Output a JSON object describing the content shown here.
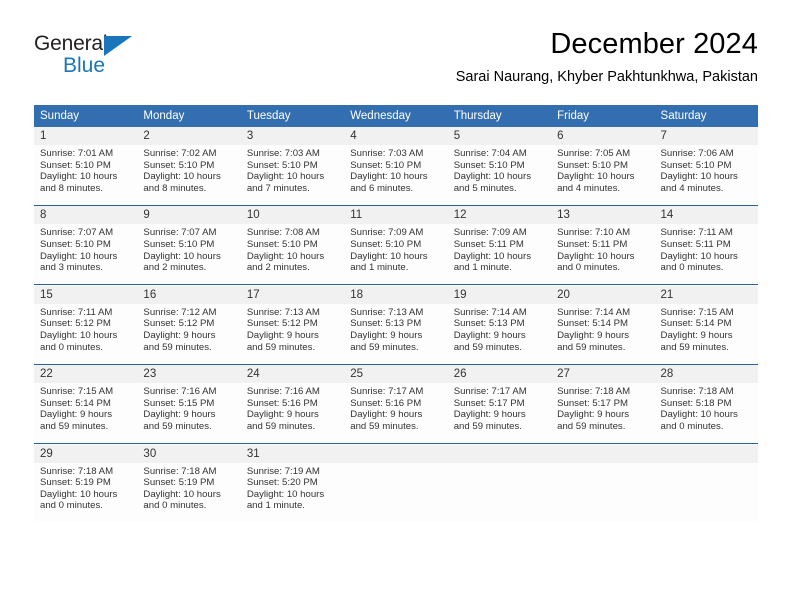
{
  "brand": {
    "name_top": "General",
    "name_bottom": "Blue",
    "accent_color": "#1b75bb",
    "triangle_icon": "triangle-icon"
  },
  "header": {
    "title": "December 2024",
    "location": "Sarai Naurang, Khyber Pakhtunkhwa, Pakistan"
  },
  "calendar": {
    "header_bg": "#336fb0",
    "daynum_bg": "#f1f1f1",
    "divider_color": "#2a6099",
    "weekdays": [
      "Sunday",
      "Monday",
      "Tuesday",
      "Wednesday",
      "Thursday",
      "Friday",
      "Saturday"
    ],
    "weeks": [
      [
        {
          "day": "1",
          "sunrise": "Sunrise: 7:01 AM",
          "sunset": "Sunset: 5:10 PM",
          "daylight1": "Daylight: 10 hours",
          "daylight2": "and 8 minutes."
        },
        {
          "day": "2",
          "sunrise": "Sunrise: 7:02 AM",
          "sunset": "Sunset: 5:10 PM",
          "daylight1": "Daylight: 10 hours",
          "daylight2": "and 8 minutes."
        },
        {
          "day": "3",
          "sunrise": "Sunrise: 7:03 AM",
          "sunset": "Sunset: 5:10 PM",
          "daylight1": "Daylight: 10 hours",
          "daylight2": "and 7 minutes."
        },
        {
          "day": "4",
          "sunrise": "Sunrise: 7:03 AM",
          "sunset": "Sunset: 5:10 PM",
          "daylight1": "Daylight: 10 hours",
          "daylight2": "and 6 minutes."
        },
        {
          "day": "5",
          "sunrise": "Sunrise: 7:04 AM",
          "sunset": "Sunset: 5:10 PM",
          "daylight1": "Daylight: 10 hours",
          "daylight2": "and 5 minutes."
        },
        {
          "day": "6",
          "sunrise": "Sunrise: 7:05 AM",
          "sunset": "Sunset: 5:10 PM",
          "daylight1": "Daylight: 10 hours",
          "daylight2": "and 4 minutes."
        },
        {
          "day": "7",
          "sunrise": "Sunrise: 7:06 AM",
          "sunset": "Sunset: 5:10 PM",
          "daylight1": "Daylight: 10 hours",
          "daylight2": "and 4 minutes."
        }
      ],
      [
        {
          "day": "8",
          "sunrise": "Sunrise: 7:07 AM",
          "sunset": "Sunset: 5:10 PM",
          "daylight1": "Daylight: 10 hours",
          "daylight2": "and 3 minutes."
        },
        {
          "day": "9",
          "sunrise": "Sunrise: 7:07 AM",
          "sunset": "Sunset: 5:10 PM",
          "daylight1": "Daylight: 10 hours",
          "daylight2": "and 2 minutes."
        },
        {
          "day": "10",
          "sunrise": "Sunrise: 7:08 AM",
          "sunset": "Sunset: 5:10 PM",
          "daylight1": "Daylight: 10 hours",
          "daylight2": "and 2 minutes."
        },
        {
          "day": "11",
          "sunrise": "Sunrise: 7:09 AM",
          "sunset": "Sunset: 5:10 PM",
          "daylight1": "Daylight: 10 hours",
          "daylight2": "and 1 minute."
        },
        {
          "day": "12",
          "sunrise": "Sunrise: 7:09 AM",
          "sunset": "Sunset: 5:11 PM",
          "daylight1": "Daylight: 10 hours",
          "daylight2": "and 1 minute."
        },
        {
          "day": "13",
          "sunrise": "Sunrise: 7:10 AM",
          "sunset": "Sunset: 5:11 PM",
          "daylight1": "Daylight: 10 hours",
          "daylight2": "and 0 minutes."
        },
        {
          "day": "14",
          "sunrise": "Sunrise: 7:11 AM",
          "sunset": "Sunset: 5:11 PM",
          "daylight1": "Daylight: 10 hours",
          "daylight2": "and 0 minutes."
        }
      ],
      [
        {
          "day": "15",
          "sunrise": "Sunrise: 7:11 AM",
          "sunset": "Sunset: 5:12 PM",
          "daylight1": "Daylight: 10 hours",
          "daylight2": "and 0 minutes."
        },
        {
          "day": "16",
          "sunrise": "Sunrise: 7:12 AM",
          "sunset": "Sunset: 5:12 PM",
          "daylight1": "Daylight: 9 hours",
          "daylight2": "and 59 minutes."
        },
        {
          "day": "17",
          "sunrise": "Sunrise: 7:13 AM",
          "sunset": "Sunset: 5:12 PM",
          "daylight1": "Daylight: 9 hours",
          "daylight2": "and 59 minutes."
        },
        {
          "day": "18",
          "sunrise": "Sunrise: 7:13 AM",
          "sunset": "Sunset: 5:13 PM",
          "daylight1": "Daylight: 9 hours",
          "daylight2": "and 59 minutes."
        },
        {
          "day": "19",
          "sunrise": "Sunrise: 7:14 AM",
          "sunset": "Sunset: 5:13 PM",
          "daylight1": "Daylight: 9 hours",
          "daylight2": "and 59 minutes."
        },
        {
          "day": "20",
          "sunrise": "Sunrise: 7:14 AM",
          "sunset": "Sunset: 5:14 PM",
          "daylight1": "Daylight: 9 hours",
          "daylight2": "and 59 minutes."
        },
        {
          "day": "21",
          "sunrise": "Sunrise: 7:15 AM",
          "sunset": "Sunset: 5:14 PM",
          "daylight1": "Daylight: 9 hours",
          "daylight2": "and 59 minutes."
        }
      ],
      [
        {
          "day": "22",
          "sunrise": "Sunrise: 7:15 AM",
          "sunset": "Sunset: 5:14 PM",
          "daylight1": "Daylight: 9 hours",
          "daylight2": "and 59 minutes."
        },
        {
          "day": "23",
          "sunrise": "Sunrise: 7:16 AM",
          "sunset": "Sunset: 5:15 PM",
          "daylight1": "Daylight: 9 hours",
          "daylight2": "and 59 minutes."
        },
        {
          "day": "24",
          "sunrise": "Sunrise: 7:16 AM",
          "sunset": "Sunset: 5:16 PM",
          "daylight1": "Daylight: 9 hours",
          "daylight2": "and 59 minutes."
        },
        {
          "day": "25",
          "sunrise": "Sunrise: 7:17 AM",
          "sunset": "Sunset: 5:16 PM",
          "daylight1": "Daylight: 9 hours",
          "daylight2": "and 59 minutes."
        },
        {
          "day": "26",
          "sunrise": "Sunrise: 7:17 AM",
          "sunset": "Sunset: 5:17 PM",
          "daylight1": "Daylight: 9 hours",
          "daylight2": "and 59 minutes."
        },
        {
          "day": "27",
          "sunrise": "Sunrise: 7:18 AM",
          "sunset": "Sunset: 5:17 PM",
          "daylight1": "Daylight: 9 hours",
          "daylight2": "and 59 minutes."
        },
        {
          "day": "28",
          "sunrise": "Sunrise: 7:18 AM",
          "sunset": "Sunset: 5:18 PM",
          "daylight1": "Daylight: 10 hours",
          "daylight2": "and 0 minutes."
        }
      ],
      [
        {
          "day": "29",
          "sunrise": "Sunrise: 7:18 AM",
          "sunset": "Sunset: 5:19 PM",
          "daylight1": "Daylight: 10 hours",
          "daylight2": "and 0 minutes."
        },
        {
          "day": "30",
          "sunrise": "Sunrise: 7:18 AM",
          "sunset": "Sunset: 5:19 PM",
          "daylight1": "Daylight: 10 hours",
          "daylight2": "and 0 minutes."
        },
        {
          "day": "31",
          "sunrise": "Sunrise: 7:19 AM",
          "sunset": "Sunset: 5:20 PM",
          "daylight1": "Daylight: 10 hours",
          "daylight2": "and 1 minute."
        },
        {
          "day": "",
          "sunrise": "",
          "sunset": "",
          "daylight1": "",
          "daylight2": ""
        },
        {
          "day": "",
          "sunrise": "",
          "sunset": "",
          "daylight1": "",
          "daylight2": ""
        },
        {
          "day": "",
          "sunrise": "",
          "sunset": "",
          "daylight1": "",
          "daylight2": ""
        },
        {
          "day": "",
          "sunrise": "",
          "sunset": "",
          "daylight1": "",
          "daylight2": ""
        }
      ]
    ]
  }
}
